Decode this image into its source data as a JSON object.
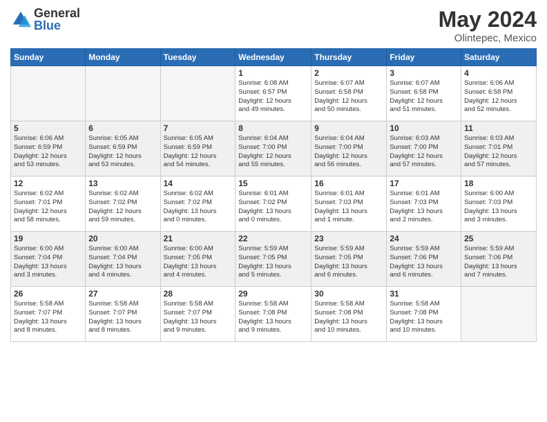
{
  "logo": {
    "general": "General",
    "blue": "Blue"
  },
  "header": {
    "month_year": "May 2024",
    "location": "Olintepec, Mexico"
  },
  "weekdays": [
    "Sunday",
    "Monday",
    "Tuesday",
    "Wednesday",
    "Thursday",
    "Friday",
    "Saturday"
  ],
  "weeks": [
    [
      {
        "day": "",
        "info": ""
      },
      {
        "day": "",
        "info": ""
      },
      {
        "day": "",
        "info": ""
      },
      {
        "day": "1",
        "info": "Sunrise: 6:08 AM\nSunset: 6:57 PM\nDaylight: 12 hours\nand 49 minutes."
      },
      {
        "day": "2",
        "info": "Sunrise: 6:07 AM\nSunset: 6:58 PM\nDaylight: 12 hours\nand 50 minutes."
      },
      {
        "day": "3",
        "info": "Sunrise: 6:07 AM\nSunset: 6:58 PM\nDaylight: 12 hours\nand 51 minutes."
      },
      {
        "day": "4",
        "info": "Sunrise: 6:06 AM\nSunset: 6:58 PM\nDaylight: 12 hours\nand 52 minutes."
      }
    ],
    [
      {
        "day": "5",
        "info": "Sunrise: 6:06 AM\nSunset: 6:59 PM\nDaylight: 12 hours\nand 53 minutes."
      },
      {
        "day": "6",
        "info": "Sunrise: 6:05 AM\nSunset: 6:59 PM\nDaylight: 12 hours\nand 53 minutes."
      },
      {
        "day": "7",
        "info": "Sunrise: 6:05 AM\nSunset: 6:59 PM\nDaylight: 12 hours\nand 54 minutes."
      },
      {
        "day": "8",
        "info": "Sunrise: 6:04 AM\nSunset: 7:00 PM\nDaylight: 12 hours\nand 55 minutes."
      },
      {
        "day": "9",
        "info": "Sunrise: 6:04 AM\nSunset: 7:00 PM\nDaylight: 12 hours\nand 56 minutes."
      },
      {
        "day": "10",
        "info": "Sunrise: 6:03 AM\nSunset: 7:00 PM\nDaylight: 12 hours\nand 57 minutes."
      },
      {
        "day": "11",
        "info": "Sunrise: 6:03 AM\nSunset: 7:01 PM\nDaylight: 12 hours\nand 57 minutes."
      }
    ],
    [
      {
        "day": "12",
        "info": "Sunrise: 6:02 AM\nSunset: 7:01 PM\nDaylight: 12 hours\nand 58 minutes."
      },
      {
        "day": "13",
        "info": "Sunrise: 6:02 AM\nSunset: 7:02 PM\nDaylight: 12 hours\nand 59 minutes."
      },
      {
        "day": "14",
        "info": "Sunrise: 6:02 AM\nSunset: 7:02 PM\nDaylight: 13 hours\nand 0 minutes."
      },
      {
        "day": "15",
        "info": "Sunrise: 6:01 AM\nSunset: 7:02 PM\nDaylight: 13 hours\nand 0 minutes."
      },
      {
        "day": "16",
        "info": "Sunrise: 6:01 AM\nSunset: 7:03 PM\nDaylight: 13 hours\nand 1 minute."
      },
      {
        "day": "17",
        "info": "Sunrise: 6:01 AM\nSunset: 7:03 PM\nDaylight: 13 hours\nand 2 minutes."
      },
      {
        "day": "18",
        "info": "Sunrise: 6:00 AM\nSunset: 7:03 PM\nDaylight: 13 hours\nand 3 minutes."
      }
    ],
    [
      {
        "day": "19",
        "info": "Sunrise: 6:00 AM\nSunset: 7:04 PM\nDaylight: 13 hours\nand 3 minutes."
      },
      {
        "day": "20",
        "info": "Sunrise: 6:00 AM\nSunset: 7:04 PM\nDaylight: 13 hours\nand 4 minutes."
      },
      {
        "day": "21",
        "info": "Sunrise: 6:00 AM\nSunset: 7:05 PM\nDaylight: 13 hours\nand 4 minutes."
      },
      {
        "day": "22",
        "info": "Sunrise: 5:59 AM\nSunset: 7:05 PM\nDaylight: 13 hours\nand 5 minutes."
      },
      {
        "day": "23",
        "info": "Sunrise: 5:59 AM\nSunset: 7:05 PM\nDaylight: 13 hours\nand 6 minutes."
      },
      {
        "day": "24",
        "info": "Sunrise: 5:59 AM\nSunset: 7:06 PM\nDaylight: 13 hours\nand 6 minutes."
      },
      {
        "day": "25",
        "info": "Sunrise: 5:59 AM\nSunset: 7:06 PM\nDaylight: 13 hours\nand 7 minutes."
      }
    ],
    [
      {
        "day": "26",
        "info": "Sunrise: 5:58 AM\nSunset: 7:07 PM\nDaylight: 13 hours\nand 8 minutes."
      },
      {
        "day": "27",
        "info": "Sunrise: 5:58 AM\nSunset: 7:07 PM\nDaylight: 13 hours\nand 8 minutes."
      },
      {
        "day": "28",
        "info": "Sunrise: 5:58 AM\nSunset: 7:07 PM\nDaylight: 13 hours\nand 9 minutes."
      },
      {
        "day": "29",
        "info": "Sunrise: 5:58 AM\nSunset: 7:08 PM\nDaylight: 13 hours\nand 9 minutes."
      },
      {
        "day": "30",
        "info": "Sunrise: 5:58 AM\nSunset: 7:08 PM\nDaylight: 13 hours\nand 10 minutes."
      },
      {
        "day": "31",
        "info": "Sunrise: 5:58 AM\nSunset: 7:08 PM\nDaylight: 13 hours\nand 10 minutes."
      },
      {
        "day": "",
        "info": ""
      }
    ]
  ]
}
